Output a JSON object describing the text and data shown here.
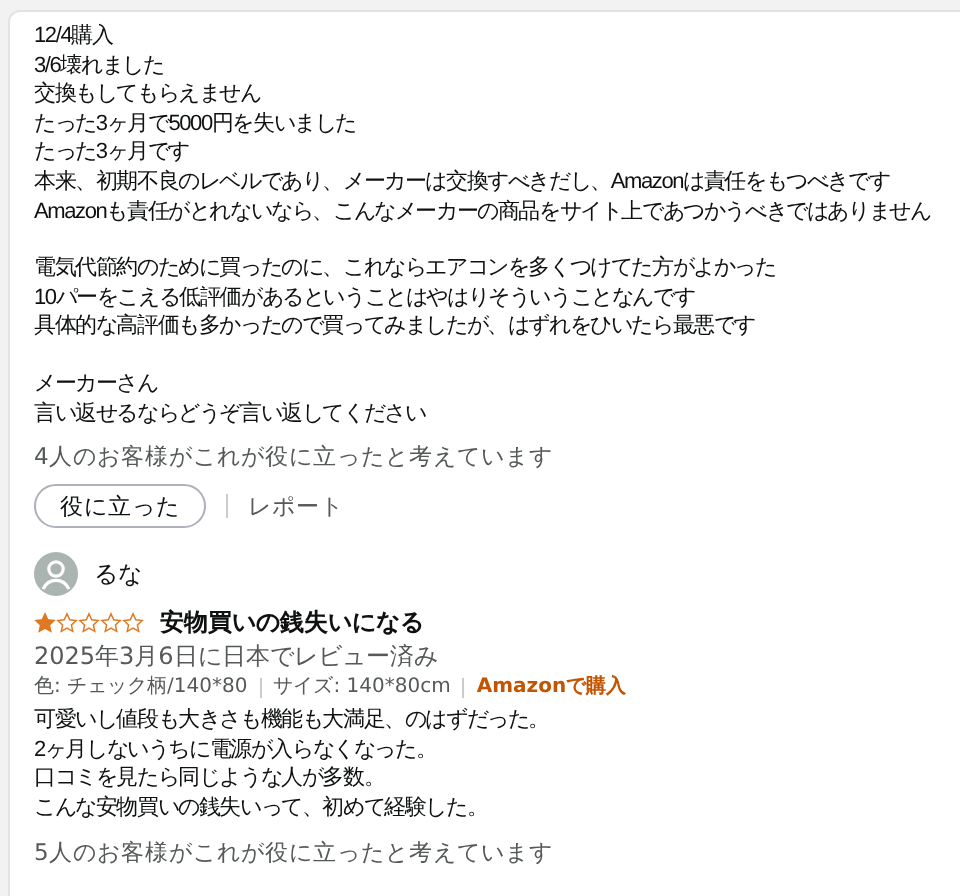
{
  "reviews": [
    {
      "paragraphs": [
        [
          "12/4購入",
          "3/6壊れました",
          "交換もしてもらえません",
          "たった3ヶ月で5000円を失いました",
          "たった3ヶ月です",
          "本来、初期不良のレベルであり、メーカーは交換すべきだし、Amazonは責任をもつべきです",
          "Amazonも責任がとれないなら、こんなメーカーの商品をサイト上であつかうべきではありません"
        ],
        [
          "電気代節約のために買ったのに、これならエアコンを多くつけてた方がよかった",
          "10パーをこえる低評価があるということはやはりそういうことなんです",
          "具体的な高評価も多かったので買ってみましたが、はずれをひいたら最悪です"
        ],
        [
          "メーカーさん",
          "言い返せるならどうぞ言い返してください"
        ]
      ],
      "helpful_text": "4人のお客様がこれが役に立ったと考えています",
      "helpful_button": "役に立った",
      "report_link": "レポート"
    },
    {
      "reviewer": "るな",
      "stars": 1,
      "title": "安物買いの銭失いになる",
      "date": "2025年3月6日に日本でレビュー済み",
      "variants": [
        "色: チェック柄/140*80",
        "サイズ: 140*80cm"
      ],
      "badge": "Amazonで購入",
      "paragraphs": [
        [
          "可愛いし値段も大きさも機能も大満足、のはずだった。",
          "2ヶ月しないうちに電源が入らなくなった。",
          "口コミを見たら同じような人が多数。",
          "こんな安物買いの銭失いって、初めて経験した。"
        ]
      ],
      "helpful_text": "5人のお客様がこれが役に立ったと考えています"
    }
  ]
}
